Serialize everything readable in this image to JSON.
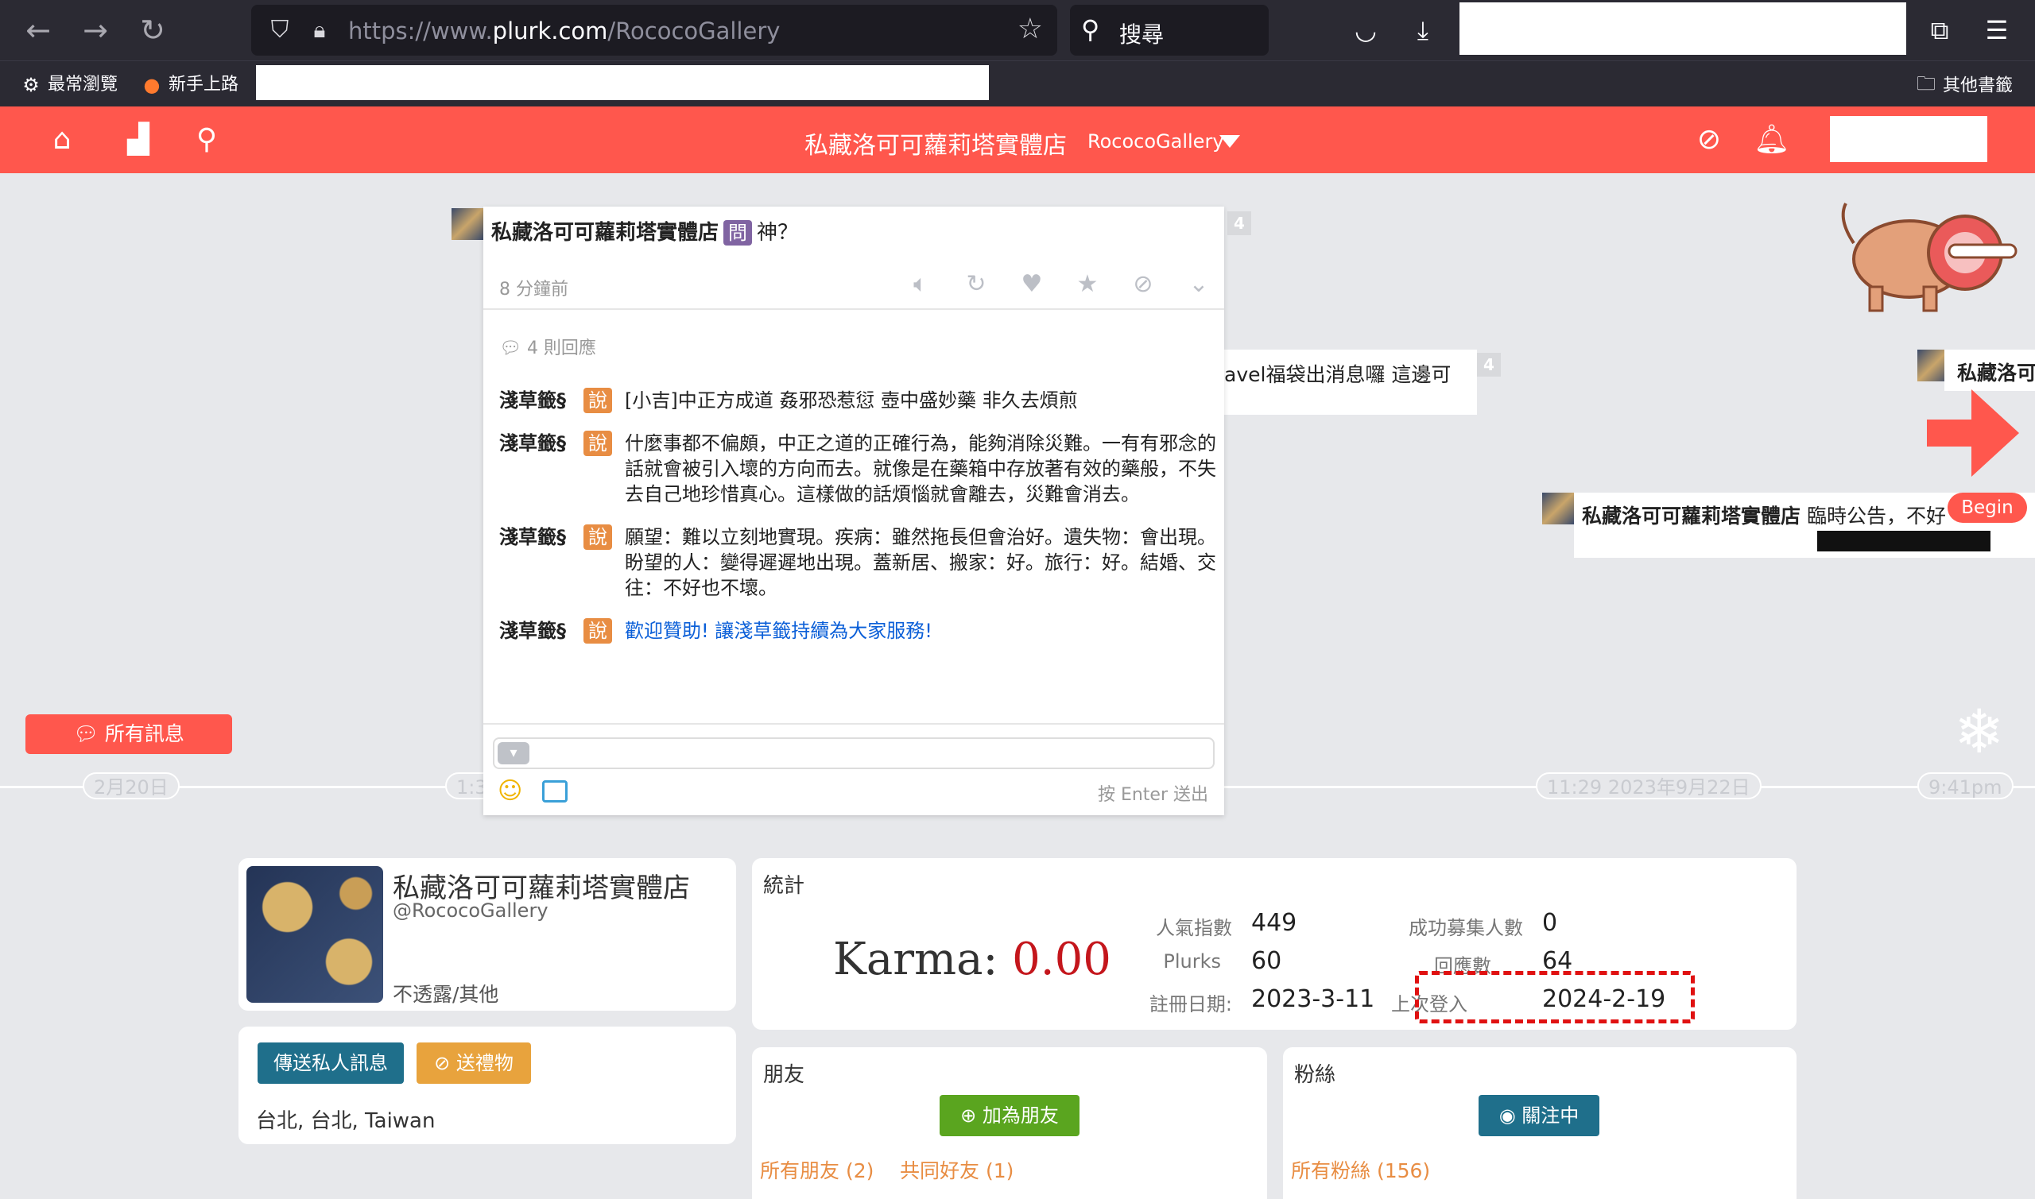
{
  "browser": {
    "url_prefix": "https://www.",
    "url_domain": "plurk.com",
    "url_path": "/RococoGallery",
    "search_label": "搜尋",
    "bookmarks": [
      {
        "label": "最常瀏覽",
        "icon": "gear-icon"
      },
      {
        "label": "新手上路",
        "icon": "firefox-icon"
      }
    ],
    "other_bookmarks": "其他書籤"
  },
  "plurkbar": {
    "title": "私藏洛可可蘿莉塔實體店",
    "nick": "RococoGallery"
  },
  "timeline": {
    "all_messages": "所有訊息",
    "dates": [
      "2月20日",
      "1:3",
      "11:29 2023年9月22日",
      "9:41pm"
    ],
    "begin_label": "Begin",
    "side_plurks": [
      {
        "text": "avel福袋出消息囉 這邊可",
        "count": "4"
      },
      {
        "owner": "私藏洛可可蘿莉塔實體店",
        "text": "臨時公告，不好"
      },
      {
        "owner": "私藏洛可"
      }
    ]
  },
  "popup": {
    "owner": "私藏洛可可蘿莉塔實體店",
    "qualifier": "問",
    "content": "神？",
    "count": "4",
    "time": "8 分鐘前",
    "reply_count": "4 則回應",
    "responses": [
      {
        "who": "淺草籤§",
        "qualifier": "說",
        "text": "[小吉]中正方成道 姦邪恐惹愆 壺中盛妙藥 非久去煩煎"
      },
      {
        "who": "淺草籤§",
        "qualifier": "說",
        "text": "什麼事都不偏頗，中正之道的正確行為，能夠消除災難。一有有邪念的話就會被引入壞的方向而去。就像是在藥箱中存放著有效的藥般，不失去自己地珍惜真心。這樣做的話煩惱就會離去，災難會消去。"
      },
      {
        "who": "淺草籤§",
        "qualifier": "說",
        "text": "願望：難以立刻地實現。疾病：雖然拖長但會治好。遺失物：會出現。盼望的人：變得遲遲地出現。蓋新居、搬家：好。旅行：好。結婚、交往：不好也不壞。"
      },
      {
        "who": "淺草籤§",
        "qualifier": "說",
        "text": "歡迎贊助! 讓淺草籤持續為大家服務!"
      }
    ],
    "enter_hint": "按 Enter 送出"
  },
  "profile": {
    "name": "私藏洛可可蘿莉塔實體店",
    "handle": "@RococoGallery",
    "relationship": "不透露/其他",
    "send_pm": "傳送私人訊息",
    "send_gift": "送禮物",
    "location": "台北, 台北, Taiwan"
  },
  "stats": {
    "title": "統計",
    "karma_label": "Karma:",
    "karma_value": "0.00",
    "rows": [
      {
        "label": "人氣指數",
        "value": "449"
      },
      {
        "label": "Plurks",
        "value": "60"
      },
      {
        "label": "註冊日期:",
        "value": "2023-3-11"
      },
      {
        "label": "成功募集人數",
        "value": "0"
      },
      {
        "label": "回應數",
        "value": "64"
      },
      {
        "label": "上次登入",
        "value": "2024-2-19"
      }
    ]
  },
  "friends": {
    "title": "朋友",
    "add_button": "加為朋友",
    "all_friends": "所有朋友 (2)",
    "common_friends": "共同好友 (1)"
  },
  "fans": {
    "title": "粉絲",
    "following_button": "關注中",
    "all_fans": "所有粉絲 (156)"
  },
  "colors": {
    "plurk_red": "#ff574d",
    "pm_button": "#1f6f8b",
    "gift_button": "#e8a33d",
    "add_friend": "#5aa51f",
    "karma_red": "#c4161c"
  }
}
